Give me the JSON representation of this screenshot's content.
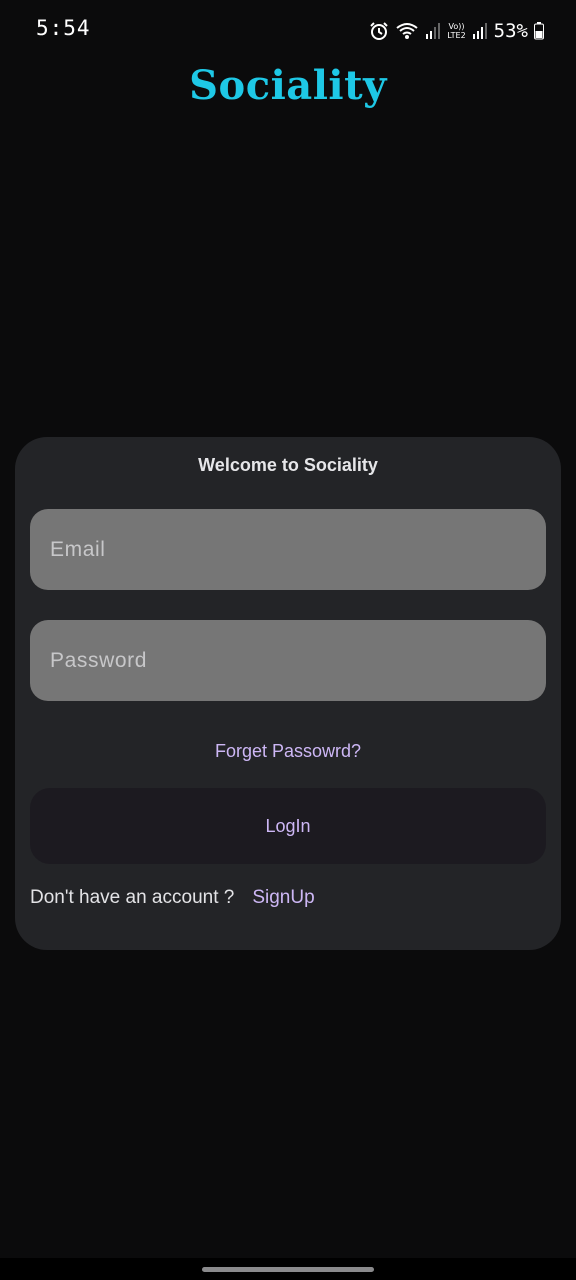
{
  "status_bar": {
    "time": "5:54",
    "network_label_top": "Vo))",
    "network_label_bottom": "LTE2",
    "battery_percent": "53%"
  },
  "app": {
    "title": "Sociality",
    "title_color": "#1ec8e6"
  },
  "login_card": {
    "heading": "Welcome to Sociality",
    "email": {
      "placeholder": "Email",
      "value": ""
    },
    "password": {
      "placeholder": "Password",
      "value": ""
    },
    "forgot_password_label": "Forget Passowrd?",
    "login_button_label": "LogIn",
    "signup_prompt": "Don't have an account ?",
    "signup_link_label": "SignUp",
    "accent_color": "#cdb7f5"
  },
  "icons": {
    "alarm": "alarm-icon",
    "wifi": "wifi-icon",
    "signal": "signal-icon",
    "battery": "battery-icon"
  }
}
